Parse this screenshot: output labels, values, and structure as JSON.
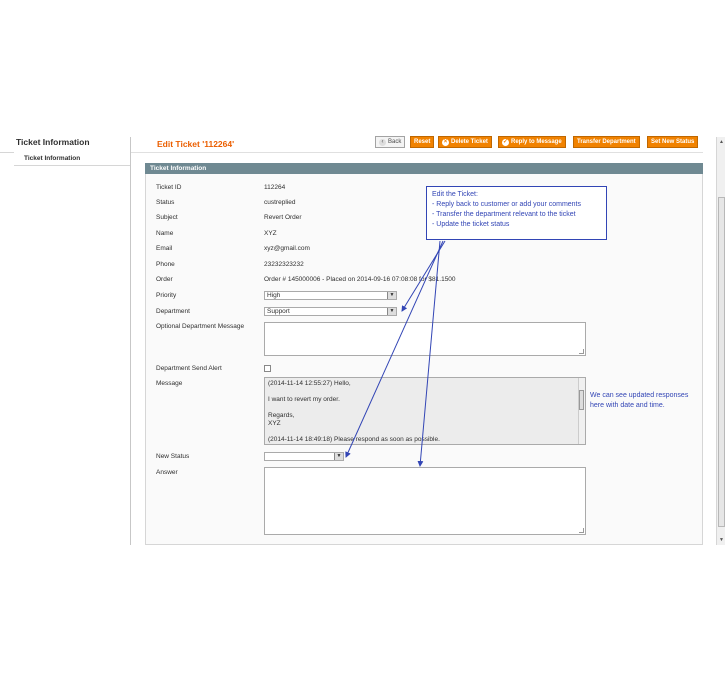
{
  "sidebar": {
    "title": "Ticket Information",
    "tabs": [
      {
        "label": "Ticket Information"
      }
    ]
  },
  "header": {
    "title": "Edit Ticket '112264'",
    "buttons": {
      "back": "Back",
      "reset": "Reset",
      "delete": "Delete Ticket",
      "reply": "Reply to Message",
      "transfer": "Transfer Department",
      "set_status": "Set New Status"
    }
  },
  "fieldset": {
    "title": "Ticket Information",
    "fields": {
      "ticket_id": {
        "label": "Ticket ID",
        "value": "112264"
      },
      "status": {
        "label": "Status",
        "value": "custreplied"
      },
      "subject": {
        "label": "Subject",
        "value": "Revert Order"
      },
      "name": {
        "label": "Name",
        "value": "XYZ"
      },
      "email": {
        "label": "Email",
        "value": "xyz@gmail.com"
      },
      "phone": {
        "label": "Phone",
        "value": "23232323232"
      },
      "order": {
        "label": "Order",
        "value": "Order # 145000006 - Placed on 2014-09-16 07:08:08 for $81.1500"
      },
      "priority": {
        "label": "Priority",
        "value": "High"
      },
      "department": {
        "label": "Department",
        "value": "Support"
      },
      "optional_dept_message": {
        "label": "Optional Department Message"
      },
      "dept_send_alert": {
        "label": "Department Send Alert"
      },
      "message": {
        "label": "Message",
        "lines": [
          "(2014-11-14 12:55:27) Hello,",
          "I want to revert my order.",
          "Regards,",
          "XYZ",
          "(2014-11-14 18:49:18) Please respond as soon as possible."
        ]
      },
      "new_status": {
        "label": "New Status",
        "value": ""
      },
      "answer": {
        "label": "Answer"
      }
    }
  },
  "annotation": {
    "callout_lines": [
      "Edit the Ticket:",
      "- Reply back to customer or add your comments",
      "- Transfer the department relevant to the ticket",
      "-  Update the ticket status"
    ],
    "side_note": "We can see updated responses here with date and time.",
    "color": "#3245b5"
  },
  "colors": {
    "accent": "#eb5e00",
    "button": "#f18200",
    "fieldset_header": "#6f8992"
  }
}
